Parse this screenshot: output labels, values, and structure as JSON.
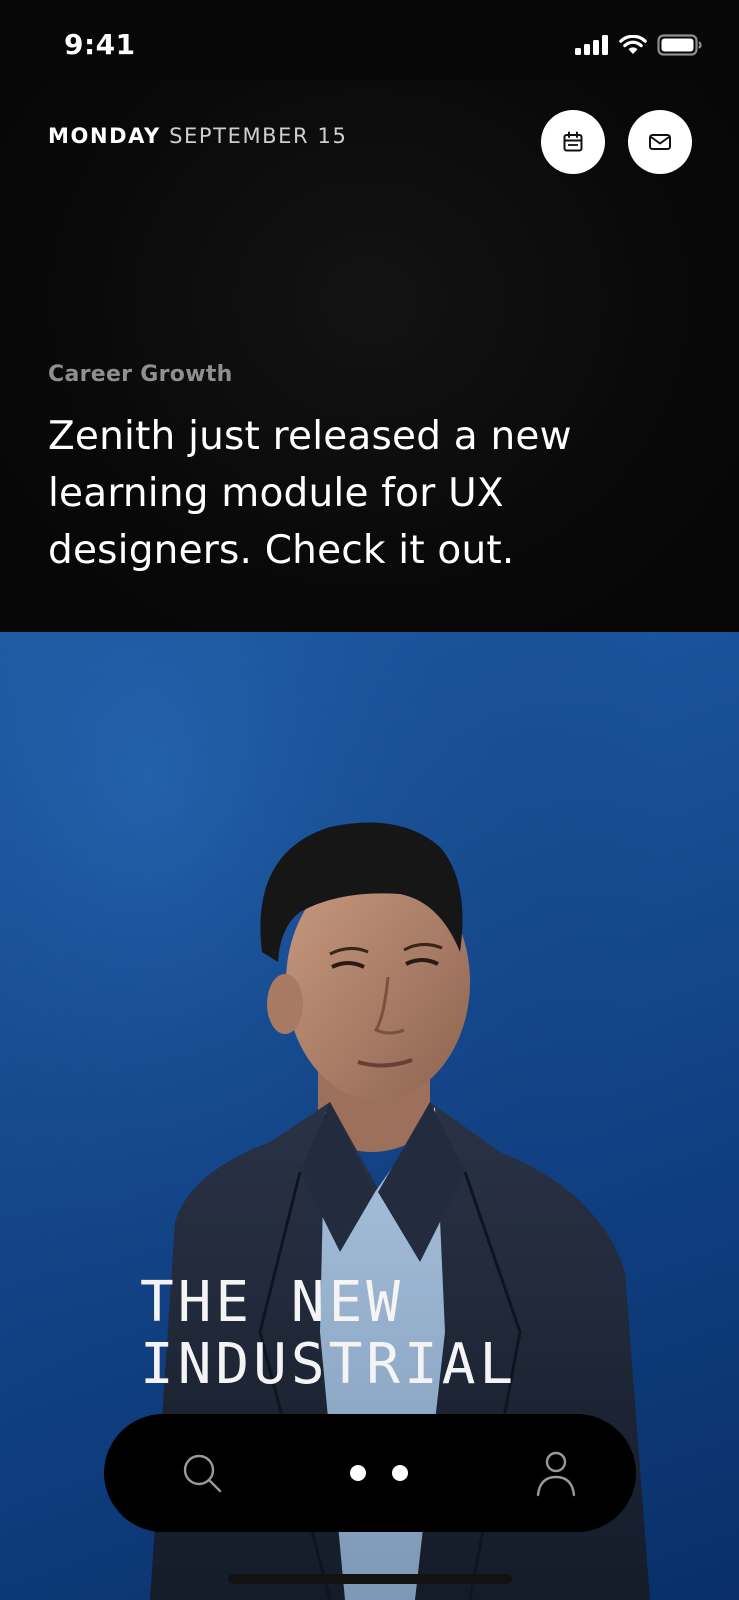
{
  "status_bar": {
    "time": "9:41"
  },
  "header": {
    "day": "MONDAY",
    "date": "SEPTEMBER 15",
    "buttons": [
      {
        "icon": "calendar-icon"
      },
      {
        "icon": "mail-icon"
      }
    ]
  },
  "feature": {
    "category": "Career Growth",
    "headline": "Zenith just released a new learning module for UX designers. Check it out."
  },
  "hero": {
    "cover_title_lines": [
      "THE NEW",
      "INDUSTRIAL"
    ],
    "background_color": "#184f95"
  },
  "bottom_nav": {
    "items": [
      {
        "icon": "search-icon"
      },
      {
        "icon": "more-dots-icon"
      },
      {
        "icon": "profile-icon"
      }
    ]
  }
}
